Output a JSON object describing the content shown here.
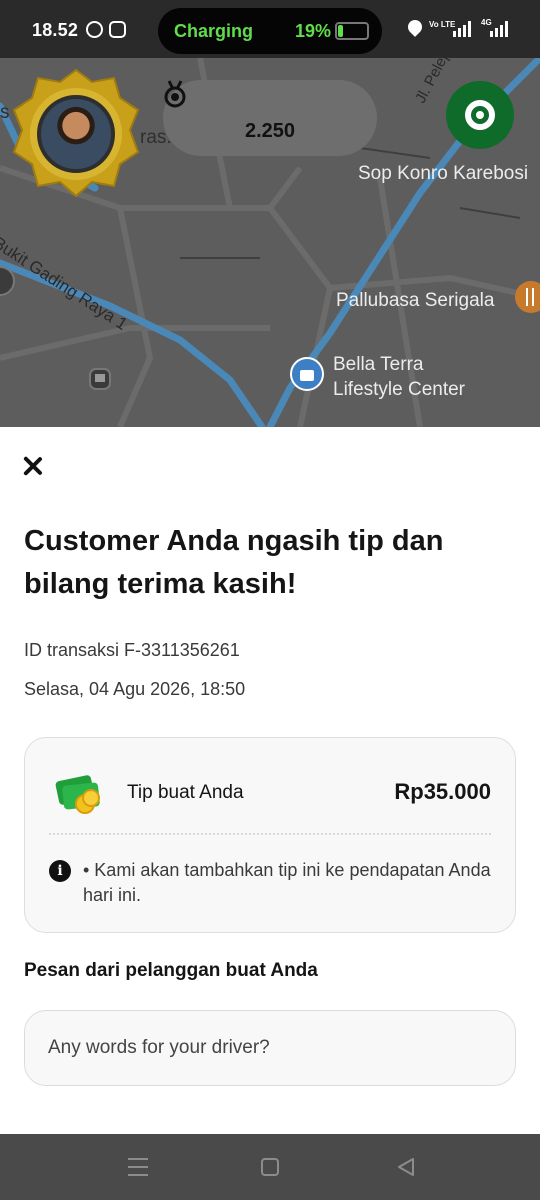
{
  "status_bar": {
    "time": "18.52",
    "charging_label": "Charging",
    "battery_percent": "19%",
    "battery_level": 0.19,
    "network_label": "Vo LTE",
    "network_type": "4G",
    "icons": [
      "whatsapp-icon",
      "instagram-icon",
      "location-icon",
      "signal-icon"
    ]
  },
  "map": {
    "score": "2.250",
    "places": [
      "Sop Konro Karebosi",
      "Pallubasa Serigala",
      "Bella Terra",
      "Lifestyle Center"
    ],
    "streets": [
      "Jl. Pelep",
      "Bukit Gading Raya 1"
    ],
    "fragments": [
      "s",
      "ras."
    ],
    "colors": {
      "map_bg": "#5d5d5d",
      "road": "#4a88b8",
      "accent": "#0f6b2a"
    }
  },
  "sheet": {
    "title": "Customer Anda ngasih tip dan bilang terima kasih!",
    "transaction_id": "ID transaksi F-3311356261",
    "datetime": "Selasa, 04 Agu 2026, 18:50",
    "tip_label": "Tip buat Anda",
    "tip_amount": "Rp35.000",
    "info_text": "• Kami akan tambahkan tip ini ke pendapatan Anda hari ini.",
    "message_section_title": "Pesan dari pelanggan buat Anda",
    "message_placeholder": "Any words for your driver?"
  },
  "nav_bar": {
    "icons": [
      "menu-icon",
      "home-icon",
      "back-icon"
    ]
  }
}
